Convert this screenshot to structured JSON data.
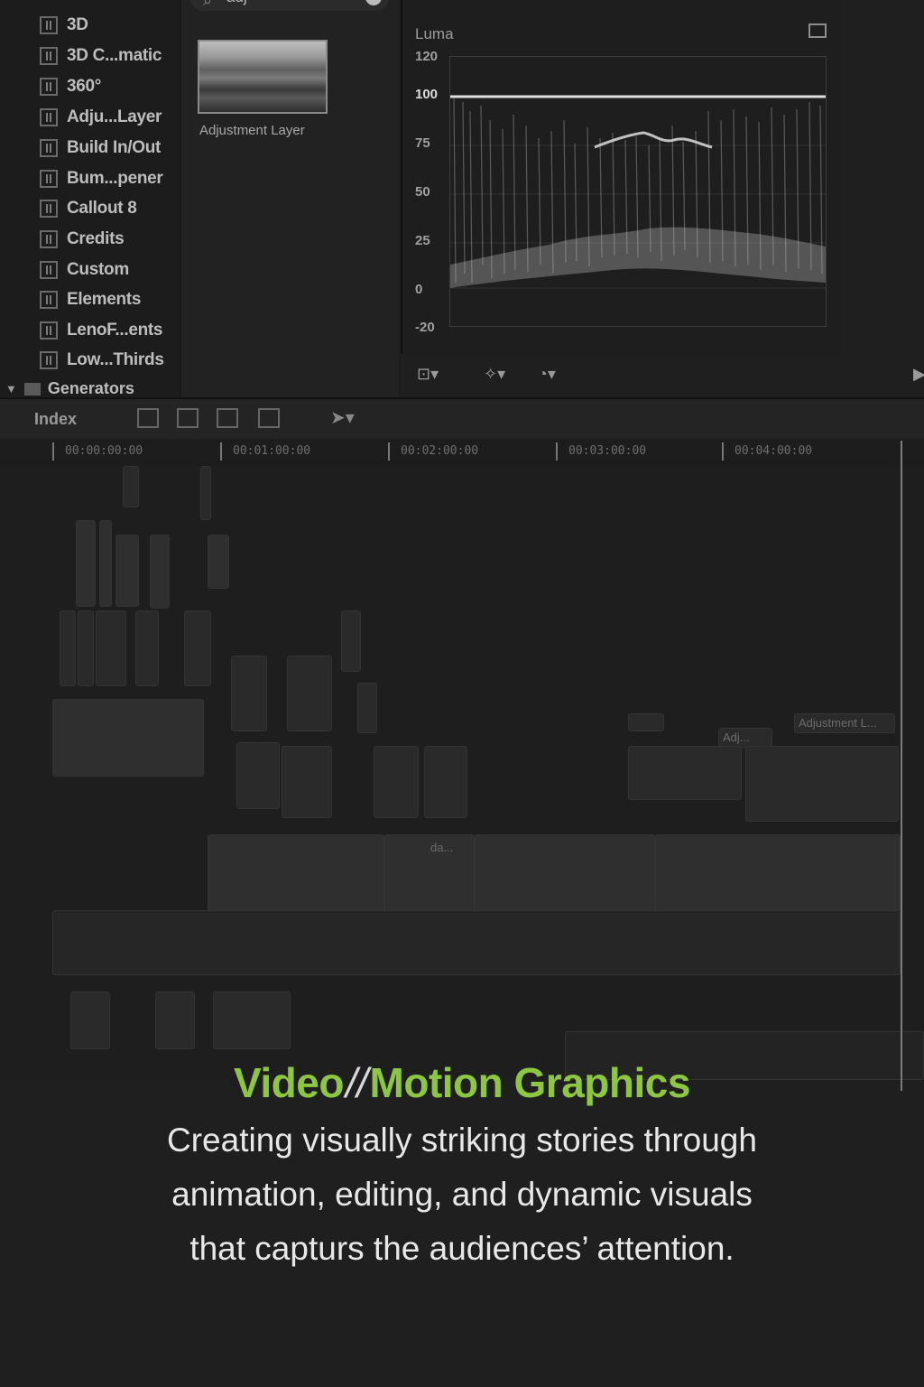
{
  "browser": {
    "items": [
      {
        "label": "3D"
      },
      {
        "label": "3D C...matic"
      },
      {
        "label": "360°"
      },
      {
        "label": "Adju...Layer"
      },
      {
        "label": "Build In/Out"
      },
      {
        "label": "Bum...pener"
      },
      {
        "label": "Callout 8"
      },
      {
        "label": "Credits"
      },
      {
        "label": "Custom"
      },
      {
        "label": "Elements"
      },
      {
        "label": "LenoF...ents"
      },
      {
        "label": "Low...Thirds"
      }
    ],
    "group": "Generators"
  },
  "effects": {
    "search_value": "adj",
    "thumbnail_label": "Adjustment Layer"
  },
  "scope": {
    "title": "Luma",
    "ticks": [
      "120",
      "100",
      "75",
      "50",
      "25",
      "0",
      "-20"
    ]
  },
  "timeline": {
    "index_label": "Index",
    "timecodes": [
      "00:00:00:00",
      "00:01:00:00",
      "00:02:00:00",
      "00:03:00:00",
      "00:04:00:00"
    ],
    "clip_labels": [
      "Adjustment L...",
      "Adj...",
      "da..."
    ]
  },
  "caption": {
    "title_left": "Video",
    "title_sep": "//",
    "title_right": "Motion Graphics",
    "lines": [
      "Creating visually striking stories through",
      "animation, editing, and dynamic visuals",
      "that capturs the audiences’ attention."
    ]
  }
}
